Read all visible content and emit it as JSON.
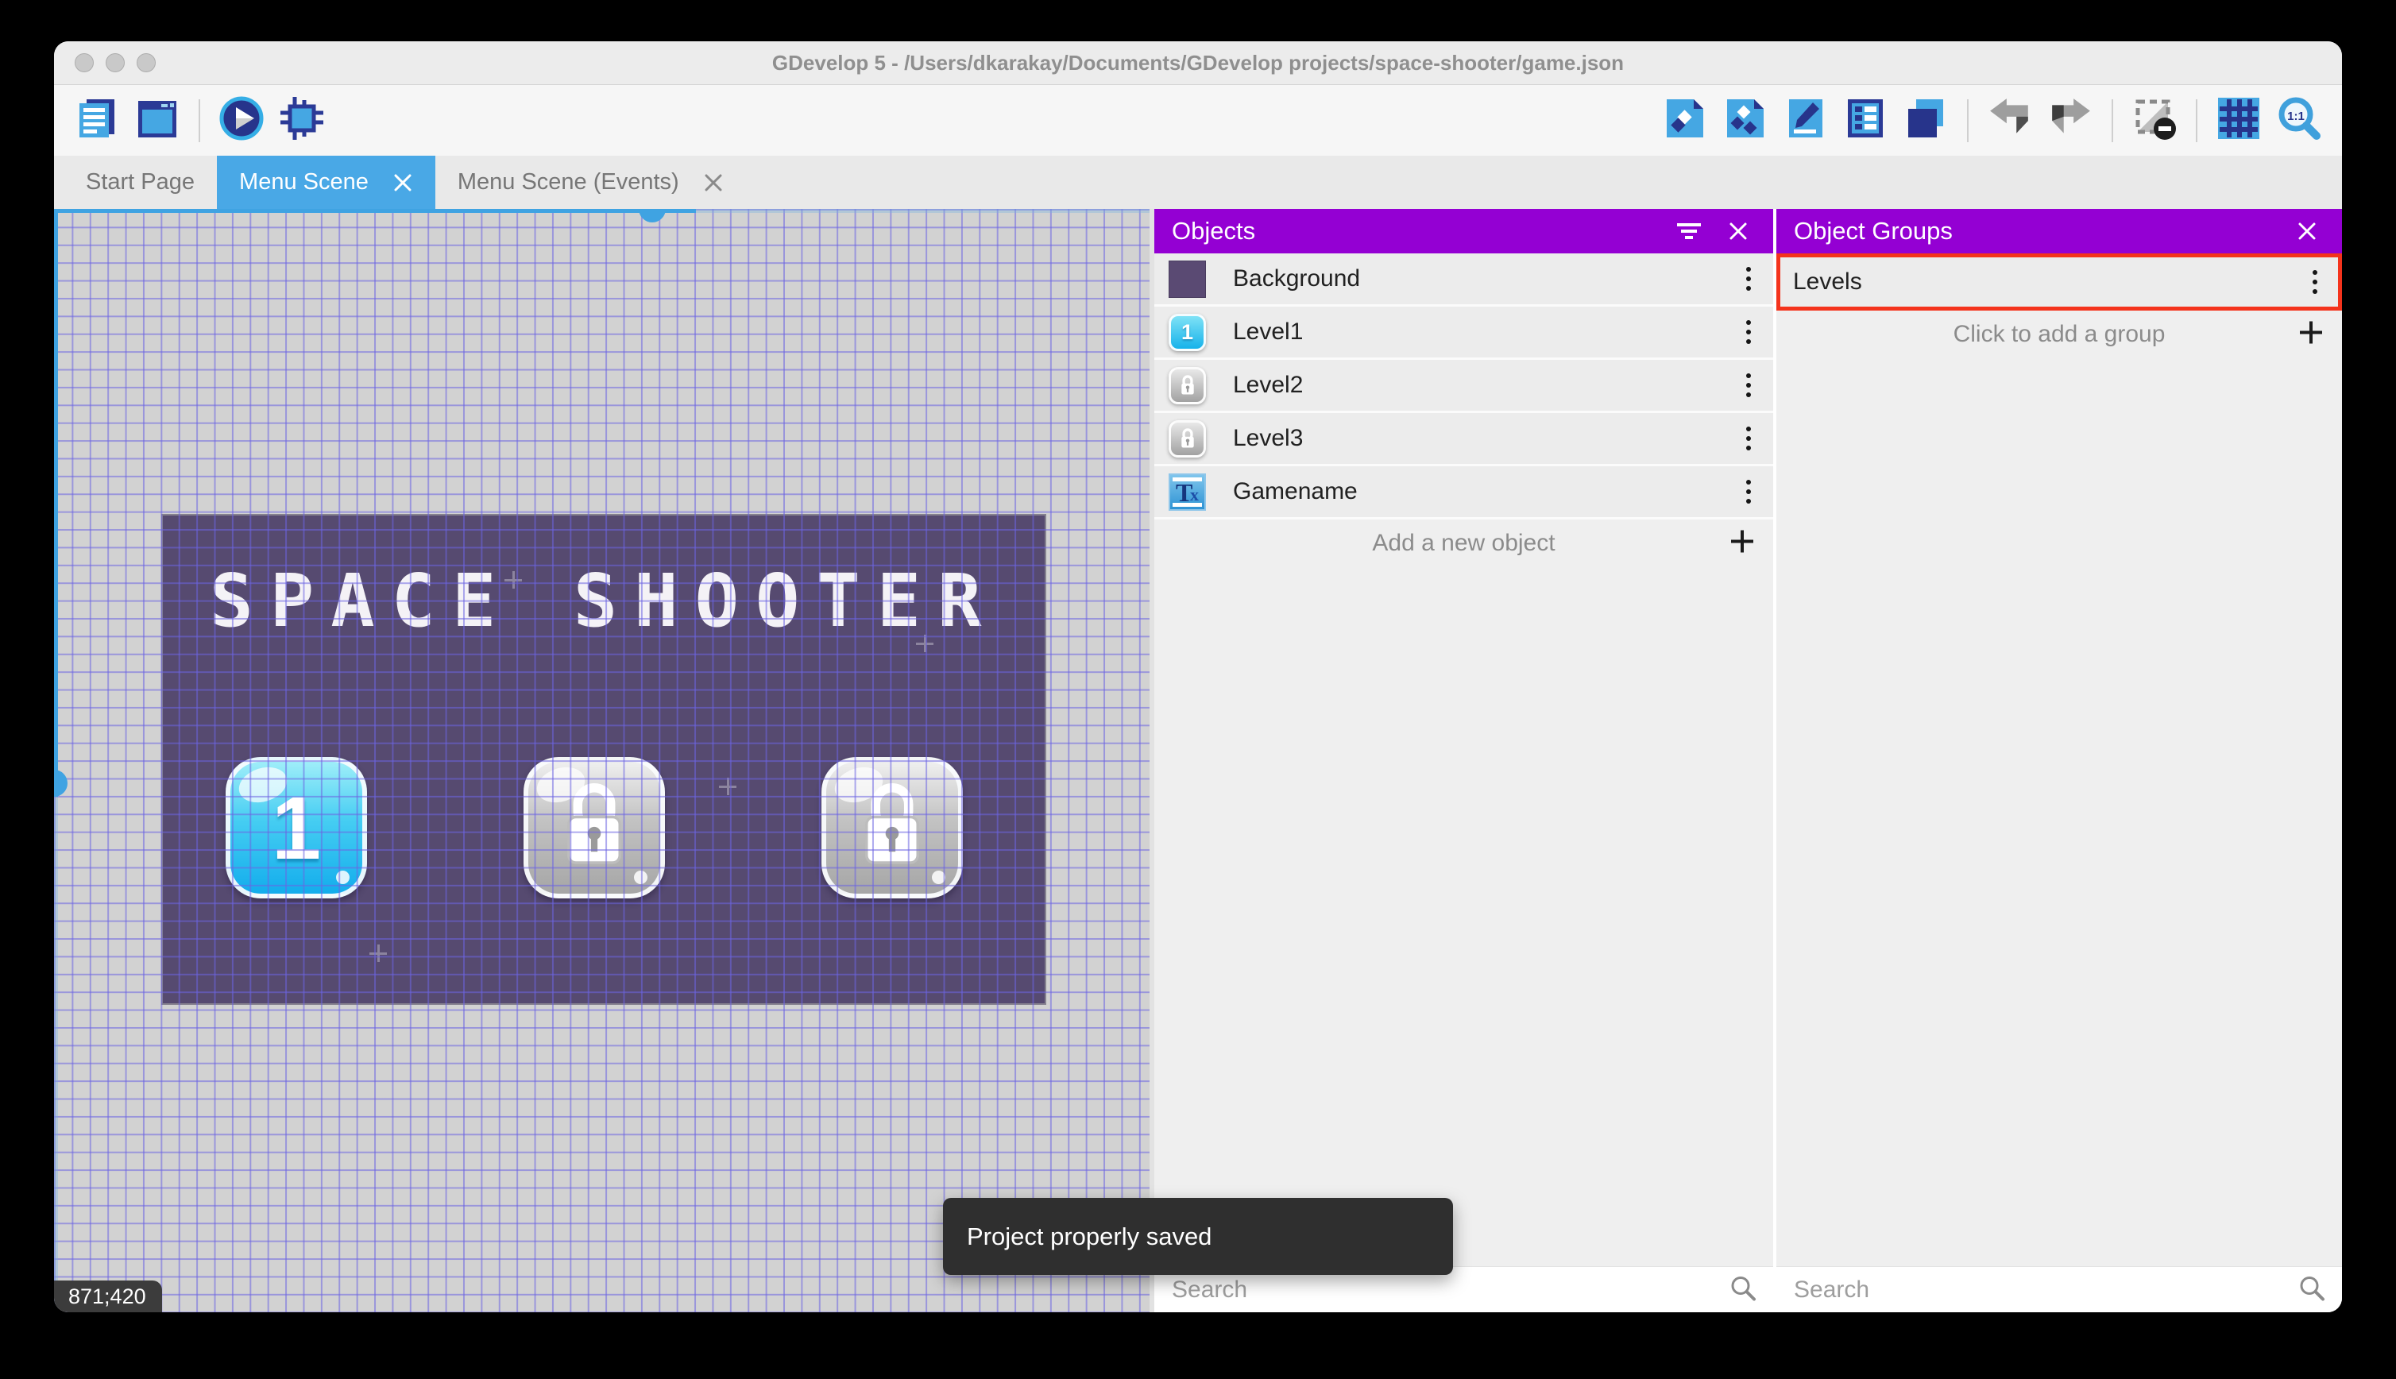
{
  "window_title": "GDevelop 5 - /Users/dkarakay/Documents/GDevelop projects/space-shooter/game.json",
  "tabs": {
    "start_page": "Start Page",
    "scene": "Menu Scene",
    "events": "Menu Scene (Events)"
  },
  "toolbar": {
    "left_icons": [
      "project-manager",
      "scene-editor",
      "preview-play",
      "debug"
    ],
    "right_icons": [
      "objects-panel",
      "object-groups-panel",
      "properties",
      "instances-list",
      "layers",
      "undo",
      "redo",
      "toggle-mask",
      "grid",
      "zoom-1-1"
    ],
    "zoom_ratio_label": "1:1"
  },
  "canvas": {
    "coordinates": "871;420",
    "scene": {
      "title_text": "SPACE SHOOTER",
      "level1_label": "1"
    }
  },
  "objects_panel": {
    "title": "Objects",
    "items": [
      {
        "name": "Background",
        "icon": "background-swatch"
      },
      {
        "name": "Level1",
        "icon": "level-button-unlocked",
        "badge": "1"
      },
      {
        "name": "Level2",
        "icon": "level-button-locked"
      },
      {
        "name": "Level3",
        "icon": "level-button-locked"
      },
      {
        "name": "Gamename",
        "icon": "text-object",
        "icon_t": "T",
        "icon_x": "x"
      }
    ],
    "add_label": "Add a new object",
    "search_placeholder": "Search"
  },
  "object_groups_panel": {
    "title": "Object Groups",
    "groups": [
      {
        "name": "Levels",
        "highlighted": true
      }
    ],
    "add_label": "Click to add a group",
    "search_placeholder": "Search"
  },
  "toast_message": "Project properly saved",
  "colors": {
    "panel_header_purple": "#9400d3",
    "active_tab_blue": "#49a8e6",
    "scrollbar_blue": "#3fa3e2",
    "scene_purple": "#564a70",
    "highlight_red": "#f4331c",
    "toast_gray": "#2f2f2f"
  }
}
